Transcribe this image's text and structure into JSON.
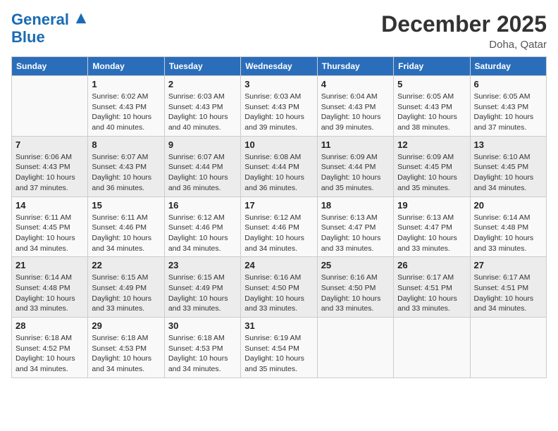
{
  "header": {
    "logo_line1": "General",
    "logo_line2": "Blue",
    "month": "December 2025",
    "location": "Doha, Qatar"
  },
  "columns": [
    "Sunday",
    "Monday",
    "Tuesday",
    "Wednesday",
    "Thursday",
    "Friday",
    "Saturday"
  ],
  "weeks": [
    [
      {
        "day": "",
        "info": ""
      },
      {
        "day": "1",
        "info": "Sunrise: 6:02 AM\nSunset: 4:43 PM\nDaylight: 10 hours\nand 40 minutes."
      },
      {
        "day": "2",
        "info": "Sunrise: 6:03 AM\nSunset: 4:43 PM\nDaylight: 10 hours\nand 40 minutes."
      },
      {
        "day": "3",
        "info": "Sunrise: 6:03 AM\nSunset: 4:43 PM\nDaylight: 10 hours\nand 39 minutes."
      },
      {
        "day": "4",
        "info": "Sunrise: 6:04 AM\nSunset: 4:43 PM\nDaylight: 10 hours\nand 39 minutes."
      },
      {
        "day": "5",
        "info": "Sunrise: 6:05 AM\nSunset: 4:43 PM\nDaylight: 10 hours\nand 38 minutes."
      },
      {
        "day": "6",
        "info": "Sunrise: 6:05 AM\nSunset: 4:43 PM\nDaylight: 10 hours\nand 37 minutes."
      }
    ],
    [
      {
        "day": "7",
        "info": "Sunrise: 6:06 AM\nSunset: 4:43 PM\nDaylight: 10 hours\nand 37 minutes."
      },
      {
        "day": "8",
        "info": "Sunrise: 6:07 AM\nSunset: 4:43 PM\nDaylight: 10 hours\nand 36 minutes."
      },
      {
        "day": "9",
        "info": "Sunrise: 6:07 AM\nSunset: 4:44 PM\nDaylight: 10 hours\nand 36 minutes."
      },
      {
        "day": "10",
        "info": "Sunrise: 6:08 AM\nSunset: 4:44 PM\nDaylight: 10 hours\nand 36 minutes."
      },
      {
        "day": "11",
        "info": "Sunrise: 6:09 AM\nSunset: 4:44 PM\nDaylight: 10 hours\nand 35 minutes."
      },
      {
        "day": "12",
        "info": "Sunrise: 6:09 AM\nSunset: 4:45 PM\nDaylight: 10 hours\nand 35 minutes."
      },
      {
        "day": "13",
        "info": "Sunrise: 6:10 AM\nSunset: 4:45 PM\nDaylight: 10 hours\nand 34 minutes."
      }
    ],
    [
      {
        "day": "14",
        "info": "Sunrise: 6:11 AM\nSunset: 4:45 PM\nDaylight: 10 hours\nand 34 minutes."
      },
      {
        "day": "15",
        "info": "Sunrise: 6:11 AM\nSunset: 4:46 PM\nDaylight: 10 hours\nand 34 minutes."
      },
      {
        "day": "16",
        "info": "Sunrise: 6:12 AM\nSunset: 4:46 PM\nDaylight: 10 hours\nand 34 minutes."
      },
      {
        "day": "17",
        "info": "Sunrise: 6:12 AM\nSunset: 4:46 PM\nDaylight: 10 hours\nand 34 minutes."
      },
      {
        "day": "18",
        "info": "Sunrise: 6:13 AM\nSunset: 4:47 PM\nDaylight: 10 hours\nand 33 minutes."
      },
      {
        "day": "19",
        "info": "Sunrise: 6:13 AM\nSunset: 4:47 PM\nDaylight: 10 hours\nand 33 minutes."
      },
      {
        "day": "20",
        "info": "Sunrise: 6:14 AM\nSunset: 4:48 PM\nDaylight: 10 hours\nand 33 minutes."
      }
    ],
    [
      {
        "day": "21",
        "info": "Sunrise: 6:14 AM\nSunset: 4:48 PM\nDaylight: 10 hours\nand 33 minutes."
      },
      {
        "day": "22",
        "info": "Sunrise: 6:15 AM\nSunset: 4:49 PM\nDaylight: 10 hours\nand 33 minutes."
      },
      {
        "day": "23",
        "info": "Sunrise: 6:15 AM\nSunset: 4:49 PM\nDaylight: 10 hours\nand 33 minutes."
      },
      {
        "day": "24",
        "info": "Sunrise: 6:16 AM\nSunset: 4:50 PM\nDaylight: 10 hours\nand 33 minutes."
      },
      {
        "day": "25",
        "info": "Sunrise: 6:16 AM\nSunset: 4:50 PM\nDaylight: 10 hours\nand 33 minutes."
      },
      {
        "day": "26",
        "info": "Sunrise: 6:17 AM\nSunset: 4:51 PM\nDaylight: 10 hours\nand 33 minutes."
      },
      {
        "day": "27",
        "info": "Sunrise: 6:17 AM\nSunset: 4:51 PM\nDaylight: 10 hours\nand 34 minutes."
      }
    ],
    [
      {
        "day": "28",
        "info": "Sunrise: 6:18 AM\nSunset: 4:52 PM\nDaylight: 10 hours\nand 34 minutes."
      },
      {
        "day": "29",
        "info": "Sunrise: 6:18 AM\nSunset: 4:53 PM\nDaylight: 10 hours\nand 34 minutes."
      },
      {
        "day": "30",
        "info": "Sunrise: 6:18 AM\nSunset: 4:53 PM\nDaylight: 10 hours\nand 34 minutes."
      },
      {
        "day": "31",
        "info": "Sunrise: 6:19 AM\nSunset: 4:54 PM\nDaylight: 10 hours\nand 35 minutes."
      },
      {
        "day": "",
        "info": ""
      },
      {
        "day": "",
        "info": ""
      },
      {
        "day": "",
        "info": ""
      }
    ]
  ]
}
